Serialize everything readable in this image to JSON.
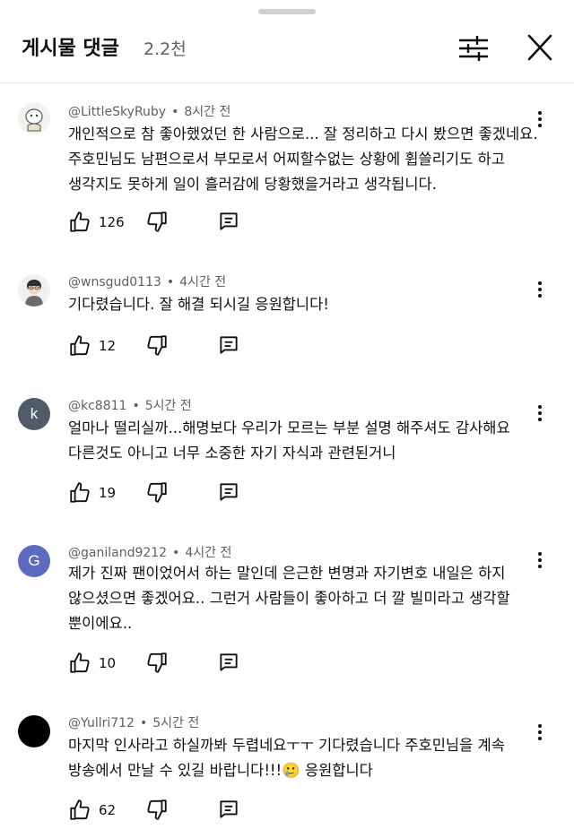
{
  "header": {
    "title": "게시물 댓글",
    "count": "2.2천",
    "filter_icon": "tune-icon",
    "close_icon": "close-icon"
  },
  "comments": [
    {
      "author": "@LittleSkyRuby",
      "time": "8시간 전",
      "text": "개인적으로 참 좋아했었던 한 사람으로... 잘 정리하고 다시 봤으면 좋겠네요.\n주호민님도 남편으로서 부모로서 어찌할수없는 상황에 휩쓸리기도 하고\n생각지도 못하게 일이 흘러감에 당황했을거라고 생각됩니다.",
      "likes": "126",
      "avatar": "cartoon-avatar"
    },
    {
      "author": "@wnsgud0113",
      "time": "4시간 전",
      "text": "기다렸습니다. 잘 해결 되시길 응원합니다!",
      "likes": "12",
      "avatar": "person-avatar"
    },
    {
      "author": "@kc8811",
      "time": "5시간 전",
      "text": "얼마나 떨리실까...해명보다 우리가 모르는 부분 설명 해주셔도 감사해요\n다른것도 아니고 너무 소중한 자기 자식과 관련된거니",
      "likes": "19",
      "avatar_letter": "k",
      "avatar_color": "#4f5b66"
    },
    {
      "author": "@ganiland9212",
      "time": "4시간 전",
      "text": "제가 진짜 팬이었어서 하는 말인데 은근한 변명과 자기변호 내일은 하지\n않으셨으면 좋겠어요.. 그런거 사람들이 좋아하고 더 깔 빌미라고 생각할\n뿐이에요..",
      "likes": "10",
      "avatar_letter": "G",
      "avatar_color": "#5c6bc0"
    },
    {
      "author": "@Yullri712",
      "time": "5시간 전",
      "text": "마지막 인사라고 하실까봐 두렵네요ㅜㅜ 기다렸습니다 주호민님을 계속\n방송에서 만날 수 있길 바랍니다!!!🥲 응원합니다",
      "likes": "62",
      "avatar_color": "#000000"
    }
  ]
}
